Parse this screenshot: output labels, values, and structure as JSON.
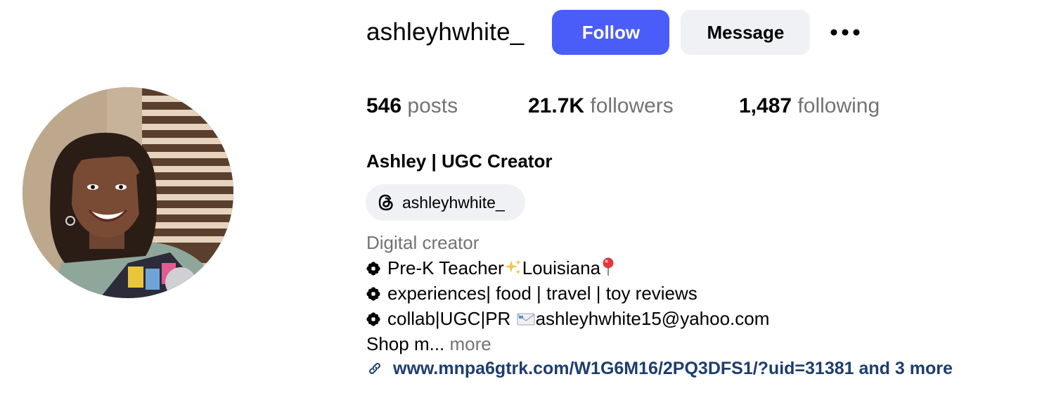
{
  "profile": {
    "username": "ashleyhwhite_",
    "full_name": "Ashley | UGC Creator",
    "avatar_alt": "Profile photo of Ashley"
  },
  "actions": {
    "follow_label": "Follow",
    "message_label": "Message",
    "more_icon": "more-horizontal-icon"
  },
  "stats": {
    "posts": {
      "count": "546",
      "label": "posts"
    },
    "followers": {
      "count": "21.7K",
      "label": "followers"
    },
    "following": {
      "count": "1,487",
      "label": "following"
    }
  },
  "threads": {
    "icon": "threads-icon",
    "handle": "ashleyhwhite_"
  },
  "bio": {
    "category": "Digital creator",
    "line1_a": "Pre-K Teacher",
    "line1_b": "Louisiana",
    "line2": "experiences| food | travel | toy reviews",
    "line3_a": "collab|UGC|PR ",
    "line3_b": "ashleyhwhite15@yahoo.com",
    "line4": "Shop m...",
    "more_label": "more"
  },
  "link": {
    "icon": "link-icon",
    "text": "www.mnpa6gtrk.com/W1G6M16/2PQ3DFS1/?uid=31381 and 3 more"
  },
  "colors": {
    "accent": "#4a5df9",
    "secondary_button": "#eff1f5",
    "muted_text": "#737373",
    "link_text": "#1d3d6e"
  }
}
